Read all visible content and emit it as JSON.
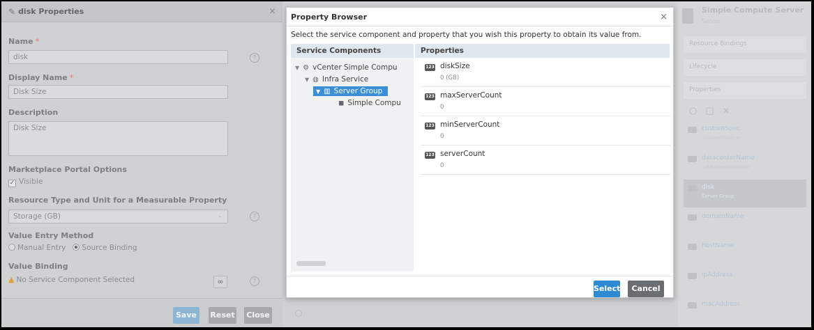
{
  "left_panel": {
    "title": "disk Properties",
    "fields": {
      "name_label": "Name",
      "name_value": "disk",
      "display_name_label": "Display Name",
      "display_name_value": "Disk Size",
      "description_label": "Description",
      "description_value": "Disk Size",
      "marketplace_label": "Marketplace Portal Options",
      "visible_label": "Visible",
      "resource_type_label": "Resource Type and Unit for a Measurable Property",
      "resource_type_value": "Storage (GB)",
      "value_entry_label": "Value Entry Method",
      "manual_entry": "Manual Entry",
      "source_binding": "Source Binding",
      "value_binding_label": "Value Binding",
      "value_binding_value": "No Service Component Selected",
      "required_marker": "*"
    },
    "buttons": {
      "save": "Save",
      "reset": "Reset",
      "close": "Close"
    }
  },
  "modal": {
    "title": "Property Browser",
    "description": "Select the service component and property that you wish this property to obtain its value from.",
    "col_components": "Service Components",
    "col_properties": "Properties",
    "tree": [
      {
        "label": "vCenter Simple Compu"
      },
      {
        "label": "Infra Service"
      },
      {
        "label": "Server Group"
      },
      {
        "label": "Simple Compu"
      }
    ],
    "properties": [
      {
        "name": "diskSize",
        "value": "0 (GB)"
      },
      {
        "name": "maxServerCount",
        "value": "0"
      },
      {
        "name": "minServerCount",
        "value": "0"
      },
      {
        "name": "serverCount",
        "value": "0"
      }
    ],
    "type_badge": "123",
    "buttons": {
      "select": "Select",
      "cancel": "Cancel"
    }
  },
  "right_panel": {
    "title": "Simple Compute Server",
    "subtitle": "Server",
    "tabs": [
      "Resource Bindings",
      "Lifecycle",
      "Properties"
    ],
    "items": [
      {
        "name": "customSpec",
        "value": "<customSpec>"
      },
      {
        "name": "datacenterName",
        "value": "<datacenterName>"
      },
      {
        "name": "disk",
        "value": "Server Group"
      },
      {
        "name": "domainName",
        "value": ""
      },
      {
        "name": "hostName",
        "value": ""
      },
      {
        "name": "ipAddress",
        "value": ""
      },
      {
        "name": "macAddress",
        "value": ""
      }
    ]
  }
}
